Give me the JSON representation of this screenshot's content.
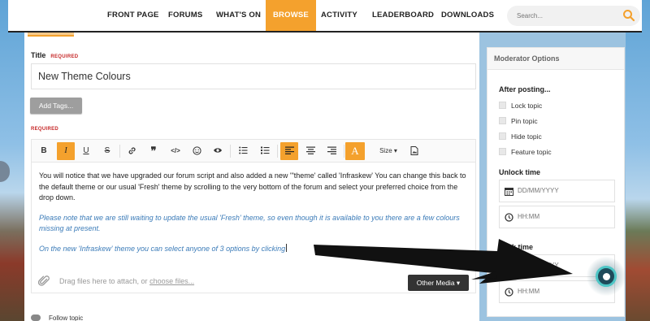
{
  "nav": {
    "items": [
      {
        "label": "FRONT PAGE"
      },
      {
        "label": "FORUMS"
      },
      {
        "label": "WHAT'S ON"
      },
      {
        "label": "BROWSE",
        "active": true
      },
      {
        "label": "ACTIVITY"
      },
      {
        "label": "LEADERBOARD"
      },
      {
        "label": "DOWNLOADS"
      }
    ],
    "search": {
      "placeholder": "Search..."
    }
  },
  "form": {
    "title_label": "Title",
    "required_text": "REQUIRED",
    "title_value": "New Theme Colours",
    "add_tags_label": "Add Tags...",
    "required_text_2": "REQUIRED"
  },
  "toolbar": {
    "bold": "B",
    "italic": "I",
    "underline": "U",
    "strike": "S",
    "size_label": "Size",
    "font_color": "A",
    "active_buttons": [
      "italic",
      "align-left",
      "font-color"
    ],
    "icons": [
      "bold-icon",
      "italic-icon",
      "underline-icon",
      "strikethrough-icon",
      "link-icon",
      "quote-icon",
      "code-icon",
      "emoji-icon",
      "spoiler-icon",
      "bullet-list-icon",
      "numbered-list-icon",
      "align-left-icon",
      "align-center-icon",
      "align-right-icon",
      "font-color-icon",
      "size-dropdown",
      "preview-icon"
    ]
  },
  "editor": {
    "paragraph1": "You will notice that we have upgraded our forum script and also added a new '\"theme' called 'Infraskew' You can change this back to the default theme or our usual 'Fresh' theme by scrolling to the very bottom of the forum and select your preferred choice from the drop down.",
    "paragraph2": "Please note that we are still waiting to update the usual 'Fresh' theme, so even though it is available to you there are a few colours missing at present.",
    "paragraph3": "On the new 'Infraskew' theme you can select anyone of 3 options by clicking",
    "attach_text": "Drag files here to attach, or ",
    "choose_files": "choose files...",
    "other_media": "Other Media"
  },
  "follow": {
    "label": "Follow topic"
  },
  "moderator": {
    "heading": "Moderator Options",
    "after_posting": "After posting...",
    "options": [
      {
        "label": "Lock topic"
      },
      {
        "label": "Pin topic"
      },
      {
        "label": "Hide topic"
      },
      {
        "label": "Feature topic"
      }
    ],
    "unlock_time": "Unlock time",
    "lock_time": "Lock time",
    "date_placeholder": "DD/MM/YYYY",
    "time_placeholder": "HH:MM"
  },
  "colors": {
    "accent": "#f4a12d",
    "required": "#c62828",
    "link_blue": "#3b7bb8",
    "nav_dark": "#222222"
  }
}
